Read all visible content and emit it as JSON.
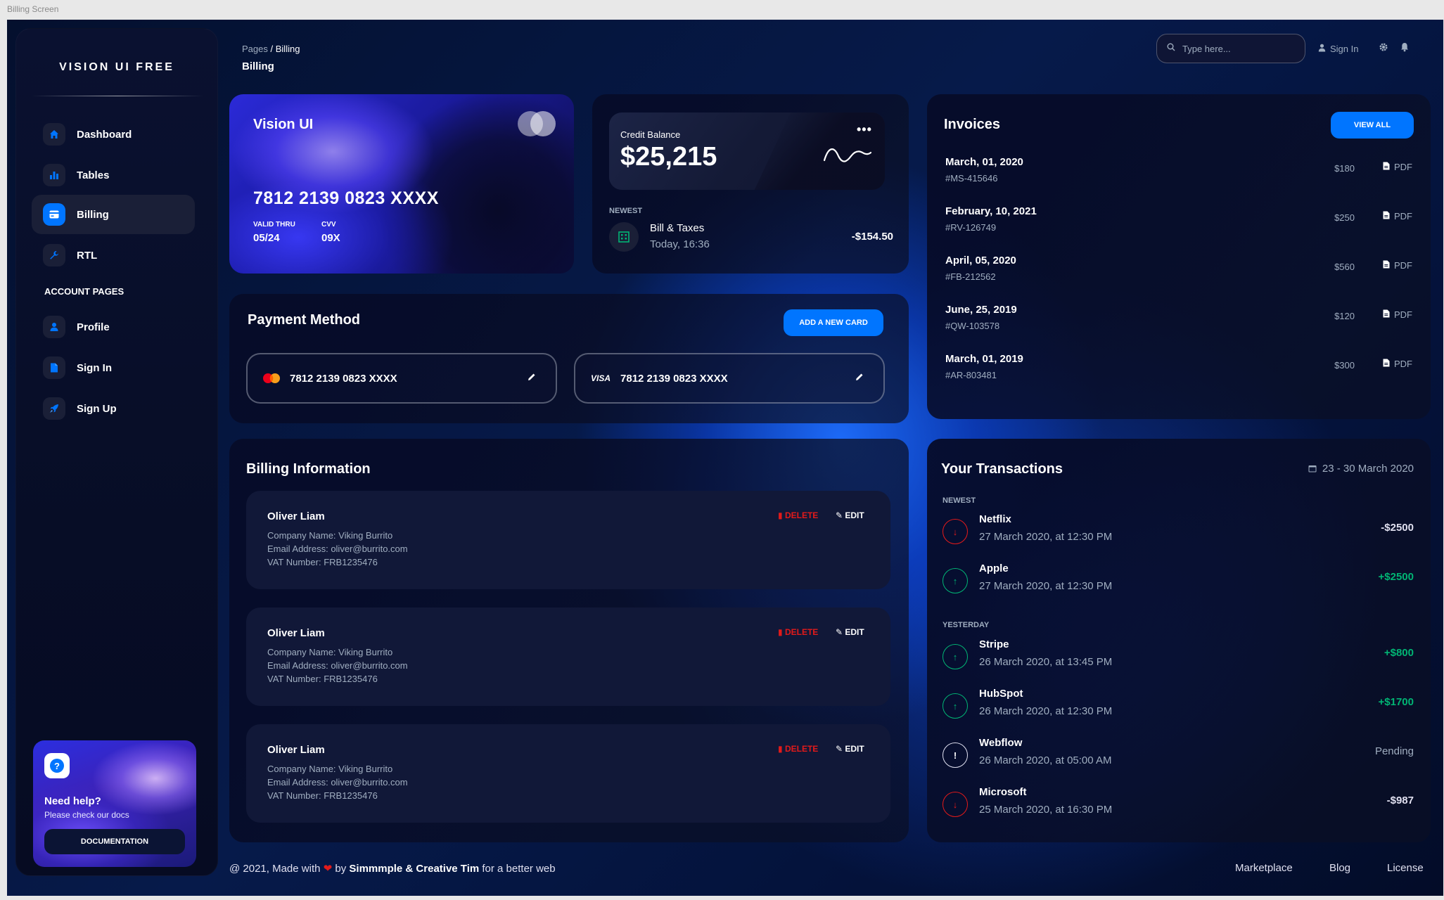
{
  "window_title": "Billing Screen",
  "sidebar": {
    "brand": "VISION UI FREE",
    "items": [
      {
        "label": "Dashboard",
        "icon": "home-icon"
      },
      {
        "label": "Tables",
        "icon": "chart-bar-icon"
      },
      {
        "label": "Billing",
        "icon": "credit-card-icon",
        "active": true
      },
      {
        "label": "RTL",
        "icon": "wrench-icon"
      }
    ],
    "section_label": "ACCOUNT PAGES",
    "account_items": [
      {
        "label": "Profile",
        "icon": "person-icon"
      },
      {
        "label": "Sign In",
        "icon": "document-icon"
      },
      {
        "label": "Sign Up",
        "icon": "rocket-icon"
      }
    ],
    "help": {
      "title": "Need help?",
      "subtitle": "Please check our docs",
      "button": "DOCUMENTATION"
    }
  },
  "header": {
    "breadcrumb_parent": "Pages",
    "breadcrumb_sep": "/",
    "breadcrumb_current": "Billing",
    "page_title": "Billing",
    "search_placeholder": "Type here...",
    "sign_in": "Sign In"
  },
  "vision_card": {
    "title": "Vision UI",
    "number": "7812 2139 0823 XXXX",
    "valid_label": "VALID THRU",
    "valid_value": "05/24",
    "cvv_label": "CVV",
    "cvv_value": "09X"
  },
  "credit_balance": {
    "label": "Credit Balance",
    "amount": "$25,215",
    "more": "•••",
    "newest_label": "NEWEST",
    "bill_title": "Bill & Taxes",
    "bill_time": "Today, 16:36",
    "bill_amount": "-$154.50"
  },
  "invoices": {
    "title": "Invoices",
    "view_all": "VIEW ALL",
    "pdf_label": "PDF",
    "rows": [
      {
        "date": "March, 01, 2020",
        "id": "#MS-415646",
        "amount": "$180"
      },
      {
        "date": "February, 10, 2021",
        "id": "#RV-126749",
        "amount": "$250"
      },
      {
        "date": "April, 05, 2020",
        "id": "#FB-212562",
        "amount": "$560"
      },
      {
        "date": "June, 25, 2019",
        "id": "#QW-103578",
        "amount": "$120"
      },
      {
        "date": "March, 01, 2019",
        "id": "#AR-803481",
        "amount": "$300"
      }
    ]
  },
  "payment": {
    "title": "Payment Method",
    "add_button": "ADD A NEW CARD",
    "cards": [
      {
        "brand": "mastercard",
        "number": "7812 2139 0823 XXXX"
      },
      {
        "brand": "VISA",
        "number": "7812 2139 0823 XXXX"
      }
    ]
  },
  "billing_info": {
    "title": "Billing Information",
    "delete_label": "DELETE",
    "edit_label": "EDIT",
    "entries": [
      {
        "name": "Oliver Liam",
        "company": "Company Name: Viking Burrito",
        "email": "Email Address: oliver@burrito.com",
        "vat": "VAT Number: FRB1235476"
      },
      {
        "name": "Oliver Liam",
        "company": "Company Name: Viking Burrito",
        "email": "Email Address: oliver@burrito.com",
        "vat": "VAT Number: FRB1235476"
      },
      {
        "name": "Oliver Liam",
        "company": "Company Name: Viking Burrito",
        "email": "Email Address: oliver@burrito.com",
        "vat": "VAT Number: FRB1235476"
      }
    ]
  },
  "transactions": {
    "title": "Your Transactions",
    "range": "23 - 30 March 2020",
    "newest_label": "NEWEST",
    "yesterday_label": "YESTERDAY",
    "rows": [
      {
        "name": "Netflix",
        "time": "27 March 2020, at 12:30 PM",
        "amount": "-$2500",
        "direction": "down"
      },
      {
        "name": "Apple",
        "time": "27 March 2020, at 12:30 PM",
        "amount": "+$2500",
        "direction": "up"
      },
      {
        "name": "Stripe",
        "time": "26 March 2020, at 13:45 PM",
        "amount": "+$800",
        "direction": "up"
      },
      {
        "name": "HubSpot",
        "time": "26 March 2020, at 12:30 PM",
        "amount": "+$1700",
        "direction": "up"
      },
      {
        "name": "Webflow",
        "time": "26 March 2020, at 05:00 AM",
        "amount": "Pending",
        "direction": "pending"
      },
      {
        "name": "Microsoft",
        "time": "25 March 2020, at 16:30 PM",
        "amount": "-$987",
        "direction": "down"
      }
    ]
  },
  "footer": {
    "prefix": "@ 2021, Made with",
    "by": "by",
    "authors": "Simmmple & Creative Tim",
    "suffix": "for a better web",
    "links": [
      "Marketplace",
      "Blog",
      "License"
    ]
  },
  "colors": {
    "accent": "#0075ff",
    "positive": "#01b574",
    "negative": "#e31a1a"
  }
}
